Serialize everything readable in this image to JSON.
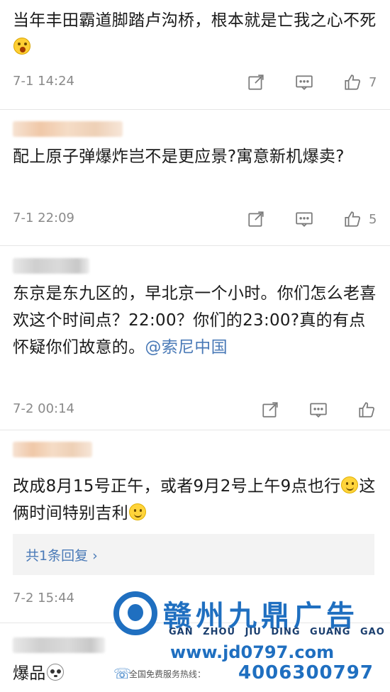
{
  "comments": [
    {
      "text": "当年丰田霸道脚踏卢沟桥，根本就是亡我之心不死",
      "time": "7-1 14:24",
      "likes": "7"
    },
    {
      "text": "配上原子弹爆炸岂不是更应景?寓意新机爆卖?",
      "time": "7-1 22:09",
      "likes": "5"
    },
    {
      "text": "东京是东九区的，早北京一个小时。你们怎么老喜欢这个时间点？22:00？你们的23:00?真的有点怀疑你们故意的。",
      "mention": "@索尼中国",
      "time": "7-2 00:14",
      "likes": ""
    },
    {
      "text_a": "改成8月15号正午，或者9月2号上午9点也行",
      "text_b": "这俩时间特别吉利",
      "reply_summary": "共1条回复 ›",
      "time": "7-2 15:44"
    },
    {
      "text": "爆品"
    }
  ],
  "icons": {
    "share": "share-icon",
    "comment": "comment-icon",
    "like": "thumb-up-icon"
  },
  "watermark": {
    "title": "赣州九鼎广告",
    "pinyin": "GAN ZHOU JIU DING GUANG GAO",
    "url": "www.jd0797.com",
    "hotline_label": "全国免费服务热线：",
    "hotline_number": "4006300797"
  },
  "colors": {
    "link": "#4a7ab7",
    "meta_gray": "#8a8a8a",
    "watermark_blue": "#1f6fc0"
  }
}
